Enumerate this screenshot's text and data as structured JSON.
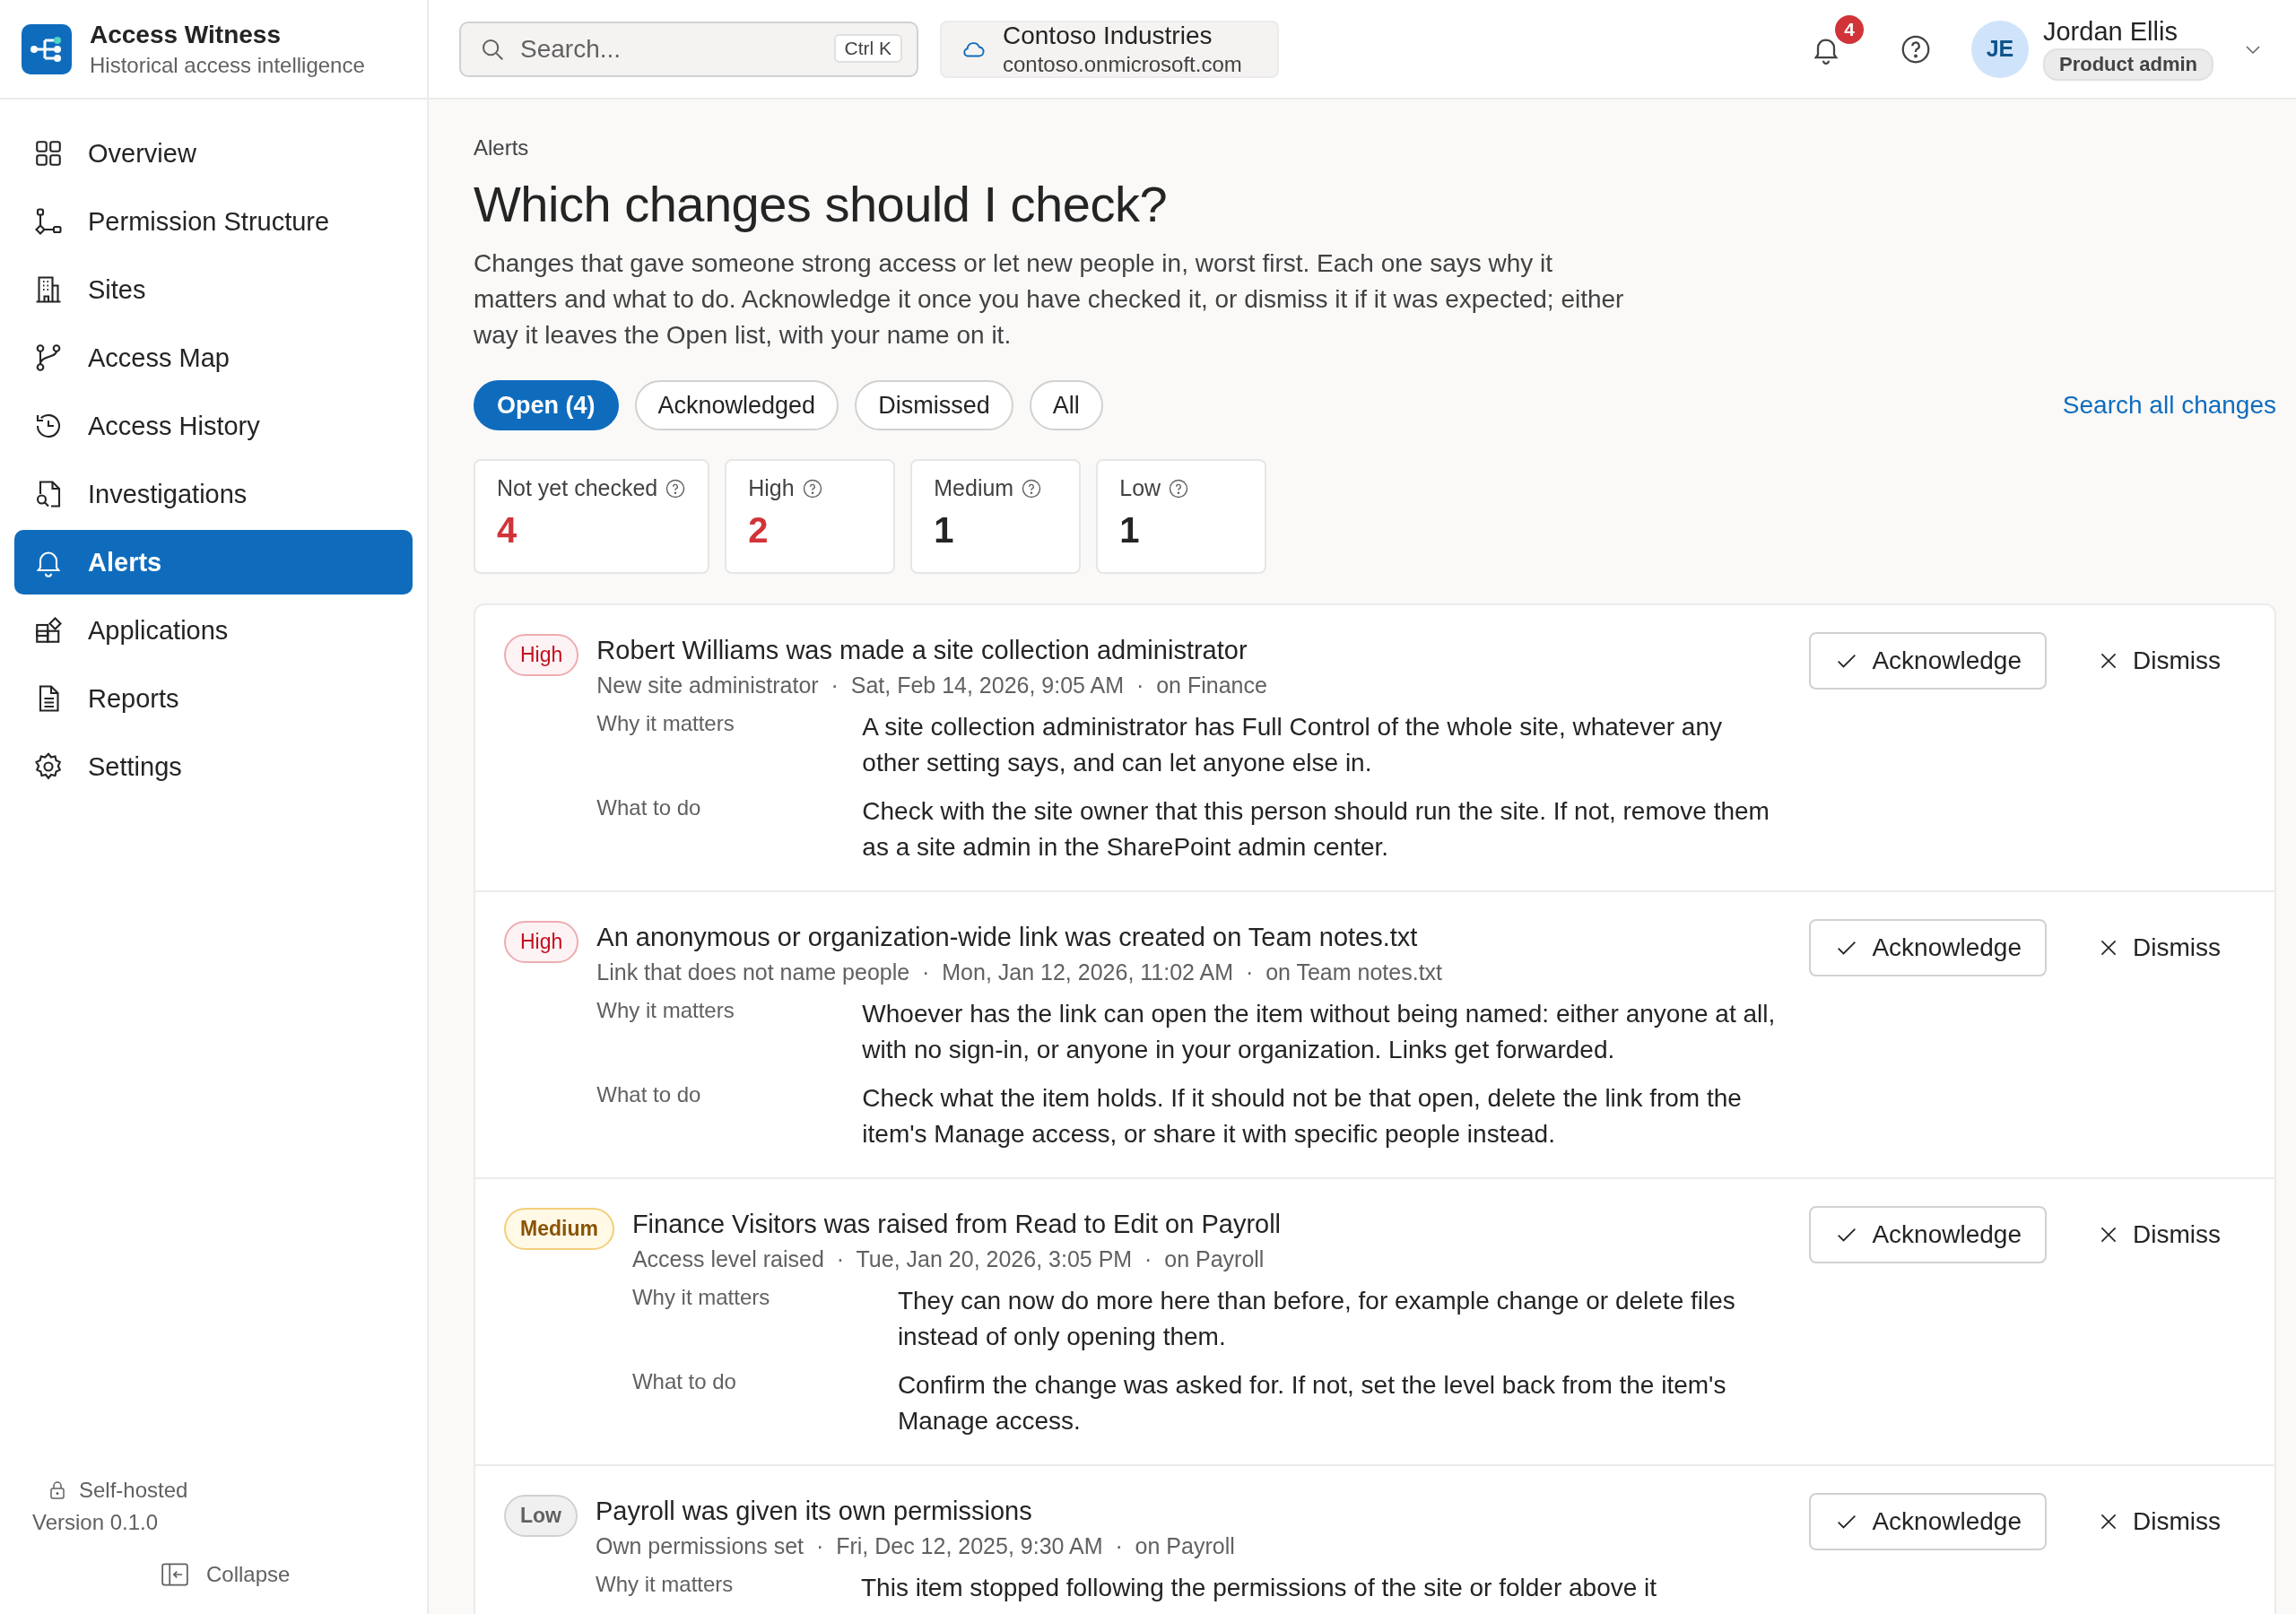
{
  "brand": {
    "name": "Access Witness",
    "tagline": "Historical access intelligence"
  },
  "search": {
    "placeholder": "Search...",
    "shortcut": "Ctrl K"
  },
  "tenant": {
    "name": "Contoso Industries",
    "domain": "contoso.onmicrosoft.com"
  },
  "notifications": {
    "count": "4"
  },
  "user": {
    "initials": "JE",
    "name": "Jordan Ellis",
    "role": "Product admin"
  },
  "sidebar": {
    "items": [
      {
        "label": "Overview",
        "selected": false
      },
      {
        "label": "Permission Structure",
        "selected": false
      },
      {
        "label": "Sites",
        "selected": false
      },
      {
        "label": "Access Map",
        "selected": false
      },
      {
        "label": "Access History",
        "selected": false
      },
      {
        "label": "Investigations",
        "selected": false
      },
      {
        "label": "Alerts",
        "selected": true
      },
      {
        "label": "Applications",
        "selected": false
      },
      {
        "label": "Reports",
        "selected": false
      },
      {
        "label": "Settings",
        "selected": false
      }
    ],
    "hosting": "Self-hosted",
    "version": "Version 0.1.0",
    "collapse": "Collapse"
  },
  "page": {
    "breadcrumb": "Alerts",
    "title": "Which changes should I check?",
    "description": "Changes that gave someone strong access or let new people in, worst first. Each one says why it matters and what to do. Acknowledge it once you have checked it, or dismiss it if it was expected; either way it leaves the Open list, with your name on it."
  },
  "filters": [
    {
      "label": "Open (4)",
      "selected": true
    },
    {
      "label": "Acknowledged",
      "selected": false
    },
    {
      "label": "Dismissed",
      "selected": false
    },
    {
      "label": "All",
      "selected": false
    }
  ],
  "search_link": "Search all changes",
  "stats": [
    {
      "label": "Not yet checked",
      "value": "4",
      "kind": "alert"
    },
    {
      "label": "High",
      "value": "2",
      "kind": "alert"
    },
    {
      "label": "Medium",
      "value": "1",
      "kind": "plain"
    },
    {
      "label": "Low",
      "value": "1",
      "kind": "plain"
    }
  ],
  "alerts": [
    {
      "severity": "High",
      "kind": "high",
      "title": "Robert Williams was made a site collection administrator",
      "meta": "New site administrator  ·  Sat, Feb 14, 2026, 9:05 AM  ·  on Finance",
      "why_label": "Why it matters",
      "why": "A site collection administrator has Full Control of the whole site, whatever any other setting says, and can let anyone else in.",
      "what_label": "What to do",
      "what": "Check with the site owner that this person should run the site. If not, remove them as a site admin in the SharePoint admin center.",
      "acknowledge": "Acknowledge",
      "dismiss": "Dismiss"
    },
    {
      "severity": "High",
      "kind": "high",
      "title": "An anonymous or organization-wide link was created on Team notes.txt",
      "meta": "Link that does not name people  ·  Mon, Jan 12, 2026, 11:02 AM  ·  on Team notes.txt",
      "why_label": "Why it matters",
      "why": "Whoever has the link can open the item without being named: either anyone at all, with no sign-in, or anyone in your organization. Links get forwarded.",
      "what_label": "What to do",
      "what": "Check what the item holds. If it should not be that open, delete the link from the item's Manage access, or share it with specific people instead.",
      "acknowledge": "Acknowledge",
      "dismiss": "Dismiss"
    },
    {
      "severity": "Medium",
      "kind": "medium",
      "title": "Finance Visitors was raised from Read to Edit on Payroll",
      "meta": "Access level raised  ·  Tue, Jan 20, 2026, 3:05 PM  ·  on Payroll",
      "why_label": "Why it matters",
      "why": "They can now do more here than before, for example change or delete files instead of only opening them.",
      "what_label": "What to do",
      "what": "Confirm the change was asked for. If not, set the level back from the item's Manage access.",
      "acknowledge": "Acknowledge",
      "dismiss": "Dismiss"
    },
    {
      "severity": "Low",
      "kind": "low",
      "title": "Payroll was given its own permissions",
      "meta": "Own permissions set  ·  Fri, Dec 12, 2025, 9:30 AM  ·  on Payroll",
      "why_label": "Why it matters",
      "why": "This item stopped following the permissions of the site or folder above it",
      "acknowledge": "Acknowledge",
      "dismiss": "Dismiss"
    }
  ]
}
